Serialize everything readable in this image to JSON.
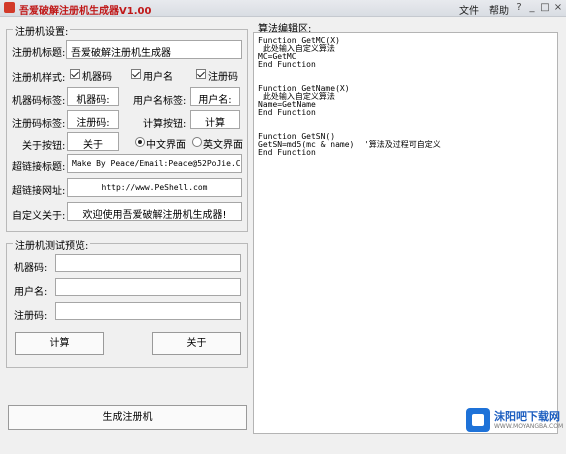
{
  "window": {
    "title": "吾爱破解注册机生成器V1.00",
    "menu": [
      "文件",
      "帮助"
    ],
    "controls": [
      "?",
      "_",
      "□",
      "×"
    ]
  },
  "settings": {
    "title": "注册机设置:",
    "keygen_title_label": "注册机标题:",
    "keygen_title_value": "吾爱破解注册机生成器",
    "style_label": "注册机样式:",
    "style_options": [
      {
        "label": "机器码",
        "checked": true
      },
      {
        "label": "用户名",
        "checked": true
      },
      {
        "label": "注册码",
        "checked": true
      }
    ],
    "machine_label_label": "机器码标签:",
    "machine_label_value": "机器码:",
    "username_label_label": "用户名标签:",
    "username_label_value": "用户名:",
    "regcode_label_label": "注册码标签:",
    "regcode_label_value": "注册码:",
    "calc_button_label": "计算按钮:",
    "calc_button_value": "计算",
    "about_button_label": "关于按钮:",
    "about_button_value": "关于",
    "ui_options": [
      {
        "label": "中文界面",
        "selected": true
      },
      {
        "label": "英文界面",
        "selected": false
      }
    ],
    "link_title_label": "超链接标题:",
    "link_title_value": "Make By Peace/Email:Peace@52PoJie.Cn",
    "link_url_label": "超链接网址:",
    "link_url_value": "http://www.PeShell.com",
    "about_label": "自定义关于:",
    "about_value": "欢迎使用吾爱破解注册机生成器!"
  },
  "preview": {
    "title": "注册机测试预览:",
    "machine_code_label": "机器码:",
    "username_label": "用户名:",
    "regcode_label": "注册码:",
    "calc_button": "计算",
    "about_button": "关于"
  },
  "generate_button": "生成注册机",
  "editor": {
    "title": "算法编辑区:",
    "code": "Function GetMC(X)\n 此处输入自定义算法\nMC=GetMC\nEnd Function\n\n\nFunction GetName(X)\n 此处输入自定义算法\nName=GetName\nEnd Function\n\n\nFunction GetSN()\nGetSN=md5(mc & name)  '算法及过程可自定义\nEnd Function"
  },
  "watermark": {
    "text": "沫阳吧下载网",
    "sub": "WWW.MOYANGBA.COM"
  }
}
